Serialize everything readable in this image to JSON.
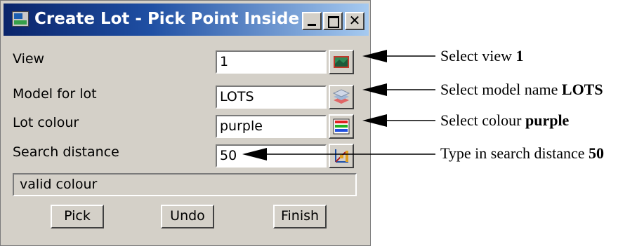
{
  "window": {
    "title": "Create Lot - Pick Point Inside",
    "controls": [
      "minimize",
      "maximize",
      "close"
    ],
    "close_glyph": "✕"
  },
  "form": {
    "view": {
      "label": "View",
      "value": "1",
      "button_icon": "view-icon"
    },
    "model": {
      "label": "Model for lot",
      "value": "LOTS",
      "button_icon": "layers-icon"
    },
    "colour": {
      "label": "Lot colour",
      "value": "purple",
      "button_icon": "colour-bars-icon"
    },
    "search": {
      "label": "Search distance",
      "value": "50",
      "button_icon": "pick-distance-icon"
    }
  },
  "status": "valid colour",
  "buttons": {
    "pick": "Pick",
    "undo": "Undo",
    "finish": "Finish"
  },
  "annotations": [
    {
      "text": "Select view ",
      "bold": "1"
    },
    {
      "text": "Select model name ",
      "bold": "LOTS"
    },
    {
      "text": "Select colour ",
      "bold": "purple"
    },
    {
      "text": "Type in search distance ",
      "bold": "50"
    }
  ]
}
